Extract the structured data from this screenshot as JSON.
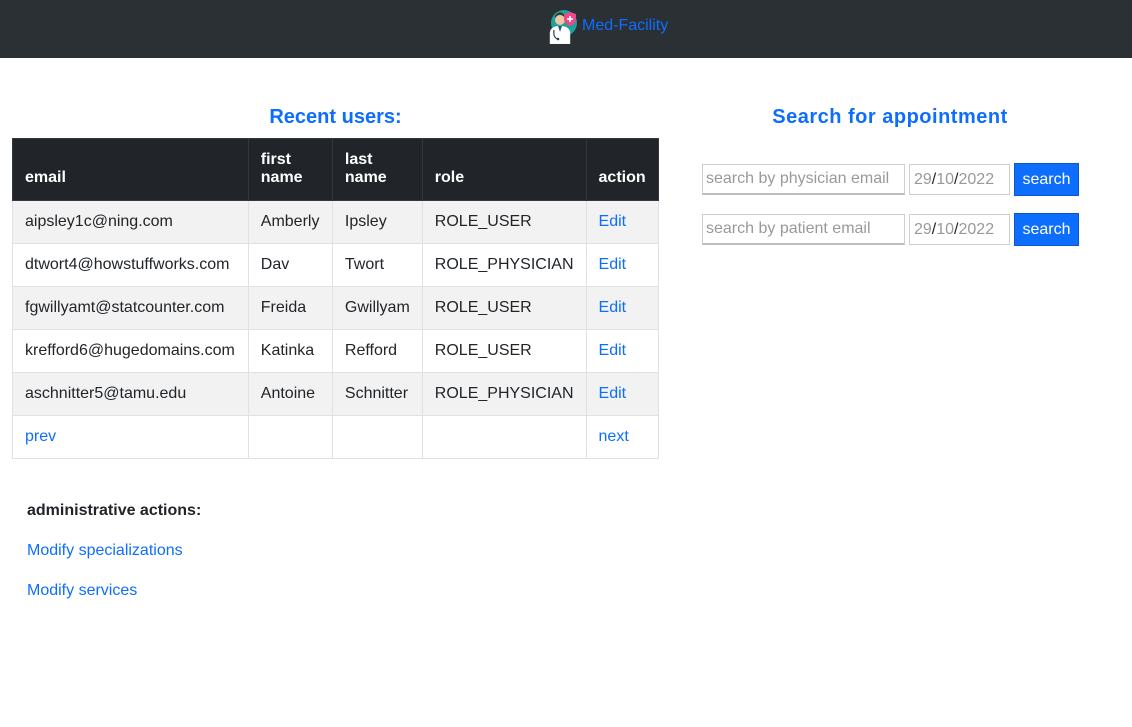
{
  "navbar": {
    "brand": "Med-Facility",
    "logo_icon": "doctor-shield-icon"
  },
  "users": {
    "title": "Recent users:",
    "headers": {
      "email": "email",
      "first_name": "first name",
      "last_name": "last name",
      "role": "role",
      "action": "action"
    },
    "rows": [
      {
        "email": "aipsley1c@ning.com",
        "first_name": "Amberly",
        "last_name": "Ipsley",
        "role": "ROLE_USER",
        "action": "Edit"
      },
      {
        "email": "dtwort4@howstuffworks.com",
        "first_name": "Dav",
        "last_name": "Twort",
        "role": "ROLE_PHYSICIAN",
        "action": "Edit"
      },
      {
        "email": "fgwillyamt@statcounter.com",
        "first_name": "Freida",
        "last_name": "Gwillyam",
        "role": "ROLE_USER",
        "action": "Edit"
      },
      {
        "email": "krefford6@hugedomains.com",
        "first_name": "Katinka",
        "last_name": "Refford",
        "role": "ROLE_USER",
        "action": "Edit"
      },
      {
        "email": "aschnitter5@tamu.edu",
        "first_name": "Antoine",
        "last_name": "Schnitter",
        "role": "ROLE_PHYSICIAN",
        "action": "Edit"
      }
    ],
    "pagination": {
      "prev": "prev",
      "next": "next"
    }
  },
  "admin": {
    "title": "administrative actions:",
    "modify_specializations": "Modify specializations",
    "modify_services": "Modify services"
  },
  "search": {
    "title": "Search for appointment",
    "physician": {
      "placeholder": "search by physician email",
      "date_day": "29",
      "date_month": "10",
      "date_year": "2022",
      "button": "search"
    },
    "patient": {
      "placeholder": "search by patient email",
      "date_day": "29",
      "date_month": "10",
      "date_year": "2022",
      "button": "search"
    }
  },
  "colors": {
    "navbar": "#2b3035",
    "accent": "#0d6efd",
    "table_header": "#212529",
    "stripe": "#f2f2f2"
  }
}
